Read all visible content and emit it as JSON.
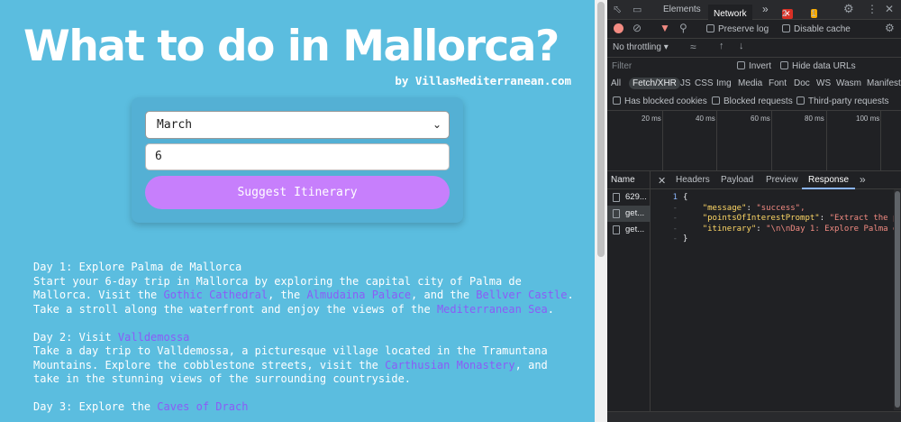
{
  "page": {
    "title": "What to do in Mallorca?",
    "byline": "by VillasMediterranean.com",
    "form": {
      "month_value": "March",
      "days_value": "6",
      "submit_label": "Suggest Itinerary"
    },
    "itinerary": {
      "day1": {
        "heading": "Day 1: Explore Palma de Mallorca",
        "t1": "Start your 6-day trip in Mallorca by exploring the capital city of Palma de Mallorca. Visit the ",
        "l1": "Gothic Cathedral",
        "t2": ", the ",
        "l2": "Almudaina Palace",
        "t3": ", and the ",
        "l3": "Bellver Castle",
        "t4": ". Take a stroll along the waterfront and enjoy the views of the ",
        "l4": "Mediterranean Sea",
        "t5": "."
      },
      "day2": {
        "heading_prefix": "Day 2: Visit ",
        "heading_link": "Valldemossa",
        "t1": "Take a day trip to Valldemossa, a picturesque village located in the Tramuntana Mountains. Explore the cobblestone streets, visit the ",
        "l1": "Carthusian Monastery",
        "t2": ", and take in the stunning views of the surrounding countryside."
      },
      "day3": {
        "heading_prefix": "Day 3: Explore the ",
        "heading_link": "Caves of Drach"
      }
    }
  },
  "devtools": {
    "tabs": [
      "Elements",
      "Network"
    ],
    "more_tabs": "»",
    "error_count": "2",
    "warning_count": "1",
    "preserve_log": "Preserve log",
    "disable_cache": "Disable cache",
    "throttling": "No throttling",
    "filter_placeholder": "Filter",
    "invert": "Invert",
    "hide_data_urls": "Hide data URLs",
    "types": [
      "All",
      "Fetch/XHR",
      "JS",
      "CSS",
      "Img",
      "Media",
      "Font",
      "Doc",
      "WS",
      "Wasm",
      "Manifest"
    ],
    "has_blocked_cookies": "Has blocked cookies",
    "blocked_requests": "Blocked requests",
    "third_party": "Third-party requests",
    "timeline_ticks": [
      "20 ms",
      "40 ms",
      "60 ms",
      "80 ms",
      "100 ms"
    ],
    "name_header": "Name",
    "requests": [
      "629...",
      "get...",
      "get..."
    ],
    "detail_tabs": [
      "Headers",
      "Payload",
      "Preview",
      "Response"
    ],
    "response": {
      "open": "{",
      "message_key": "\"message\"",
      "message_val": "\"success\",",
      "poi_key": "\"pointsOfInterestPrompt\"",
      "poi_val": "\"Extract the p",
      "itin_key": "\"itinerary\"",
      "itin_val": "\"\\n\\nDay 1: Explore Palma d",
      "close": "}"
    },
    "colors": {
      "accent": "#8ab4f8",
      "record": "#f28b82",
      "page_bg": "#5bbddf",
      "button": "#c77ffc",
      "link": "#8b5cf6"
    }
  }
}
